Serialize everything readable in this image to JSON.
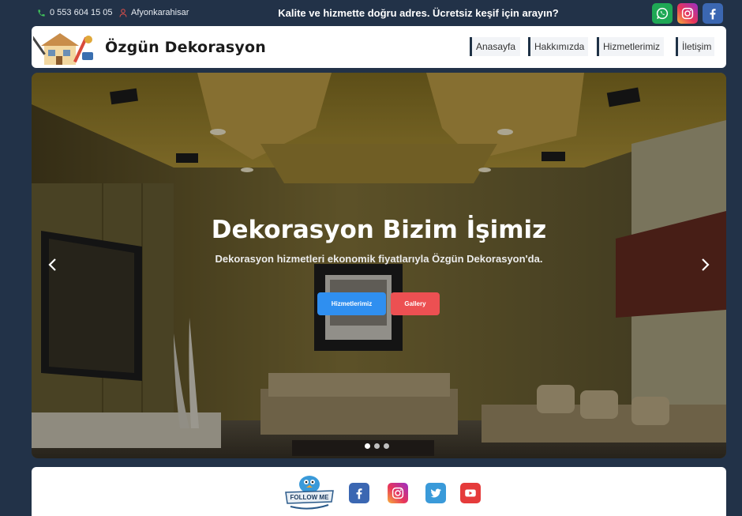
{
  "topbar": {
    "phone": "0 553 604 15 05",
    "location": "Afyonkarahisar",
    "slogan": "Kalite ve hizmette doğru adres. Ücretsiz keşif için arayın?",
    "social": [
      "whatsapp-icon",
      "instagram-icon",
      "facebook-icon"
    ]
  },
  "header": {
    "brand": "Özgün Dekorasyon",
    "nav": [
      "Anasayfa",
      "Hakkımızda",
      "Hizmetlerimiz",
      "İletişim"
    ]
  },
  "hero": {
    "title": "Dekorasyon Bizim İşimiz",
    "subtitle": "Dekorasyon hizmetleri ekonomik fiyatlarıyla Özgün Dekorasyon'da.",
    "buttons": {
      "primary": "Hizmetlerimiz",
      "secondary": "Gallery"
    },
    "slides_total": 3,
    "slide_active": 1
  },
  "follow": {
    "badge": "FOLLOW ME",
    "icons": [
      "facebook-icon",
      "instagram-icon",
      "twitter-icon",
      "youtube-icon"
    ]
  },
  "colors": {
    "page_bg": "#223248",
    "primary_button": "#2f8ff0",
    "secondary_button": "#ec5052",
    "nav_accent": "#1f3246"
  }
}
